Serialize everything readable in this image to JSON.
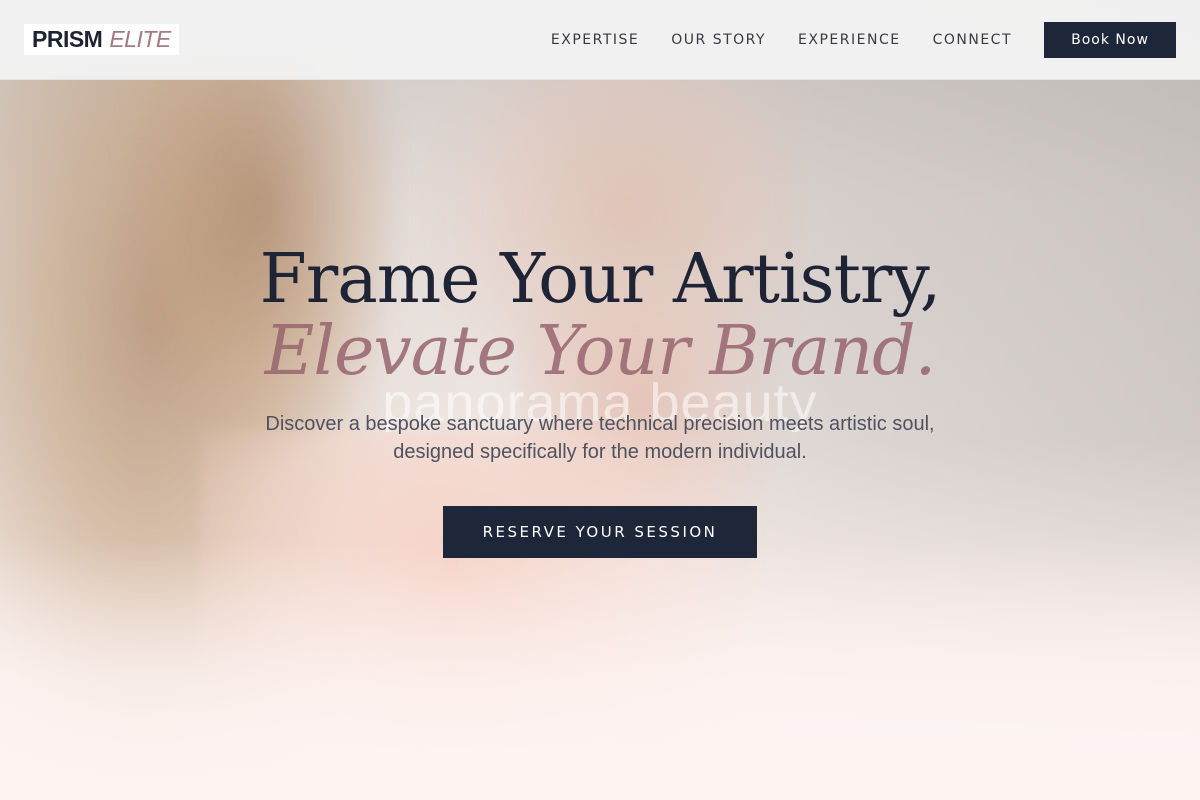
{
  "brand": {
    "name_main": "PRISM",
    "name_sub": "ELITE"
  },
  "nav": {
    "items": [
      {
        "label": "EXPERTISE"
      },
      {
        "label": "OUR STORY"
      },
      {
        "label": "EXPERIENCE"
      },
      {
        "label": "CONNECT"
      }
    ],
    "book_label": "Book Now"
  },
  "hero": {
    "headline_line1": "Frame Your Artistry,",
    "headline_line2": "Elevate Your Brand.",
    "watermark": "panorama beauty",
    "subtext": "Discover a bespoke sanctuary where technical precision meets artistic soul, designed specifically for the modern individual.",
    "cta_label": "RESERVE YOUR SESSION",
    "image_description": "woman-profile-photo"
  },
  "colors": {
    "primary_dark": "#1e2639",
    "accent_rose": "#a27a80",
    "header_bg": "#f3f3f3",
    "hero_bg": "#fdf4f2"
  }
}
